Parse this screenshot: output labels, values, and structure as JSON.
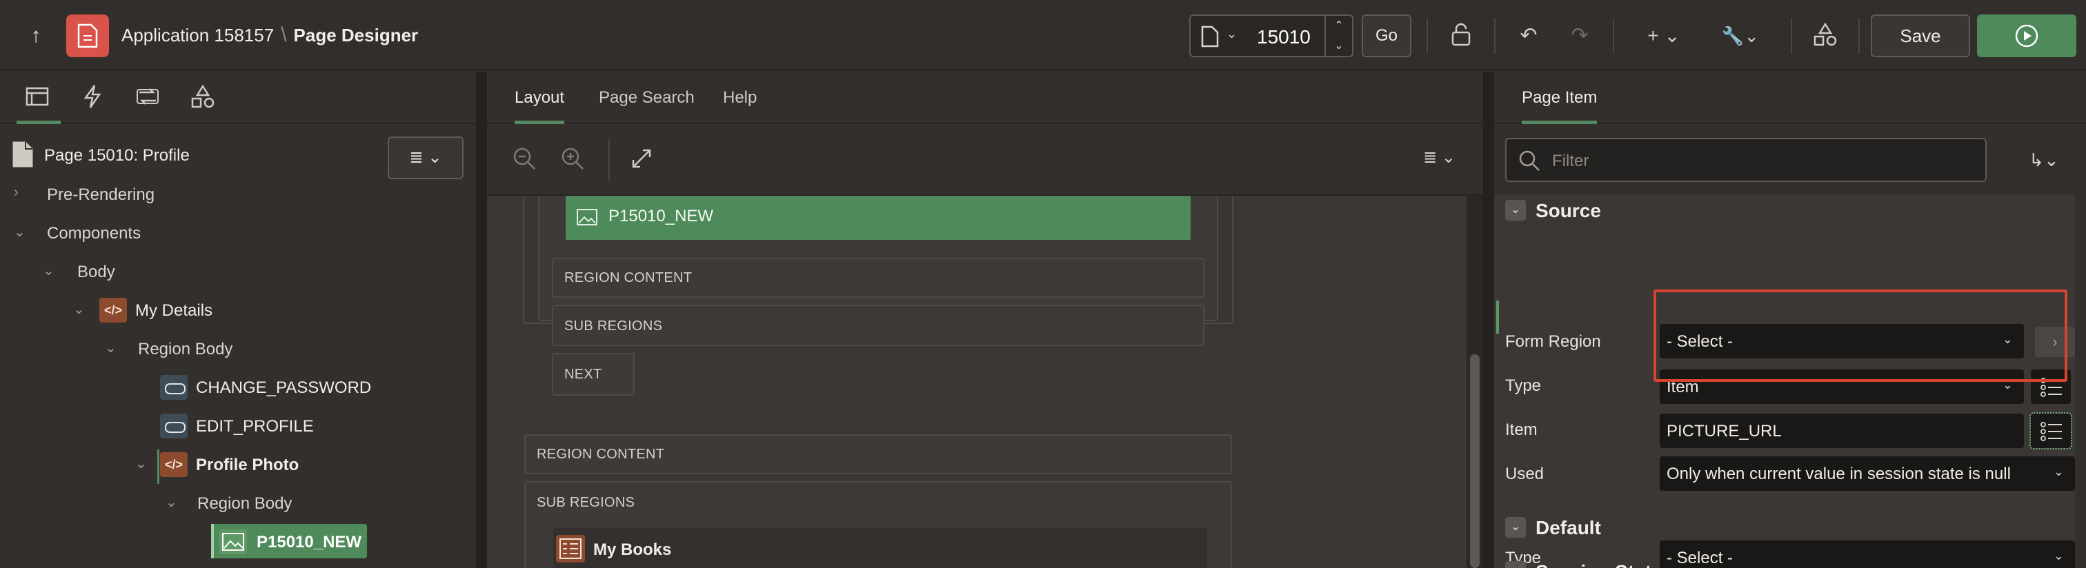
{
  "header": {
    "app": "Application 158157",
    "page": "Page Designer",
    "page_number": "15010",
    "go": "Go",
    "save": "Save"
  },
  "tree": {
    "page_title": "Page 15010: Profile",
    "items": [
      {
        "label": "Pre-Rendering"
      },
      {
        "label": "Components"
      },
      {
        "label": "Body"
      },
      {
        "label": "My Details"
      },
      {
        "label": "Region Body"
      },
      {
        "label": "CHANGE_PASSWORD"
      },
      {
        "label": "EDIT_PROFILE"
      },
      {
        "label": "Profile Photo"
      },
      {
        "label": "Region Body"
      },
      {
        "label": "P15010_NEW"
      }
    ]
  },
  "center": {
    "tabs": [
      "Layout",
      "Page Search",
      "Help"
    ],
    "item": "P15010_NEW",
    "inner": [
      "REGION CONTENT",
      "SUB REGIONS",
      "NEXT"
    ],
    "outer": [
      "REGION CONTENT",
      "SUB REGIONS"
    ],
    "region": "My Books"
  },
  "props": {
    "tab": "Page Item",
    "filter_placeholder": "Filter",
    "source": {
      "title": "Source",
      "form_region_label": "Form Region",
      "form_region_value": "- Select -",
      "type_label": "Type",
      "type_value": "Item",
      "item_label": "Item",
      "item_value": "PICTURE_URL",
      "used_label": "Used",
      "used_value": "Only when current value in session state is null"
    },
    "default": {
      "title": "Default",
      "type_label": "Type",
      "type_value": "- Select -"
    },
    "next_section": "Session State"
  }
}
